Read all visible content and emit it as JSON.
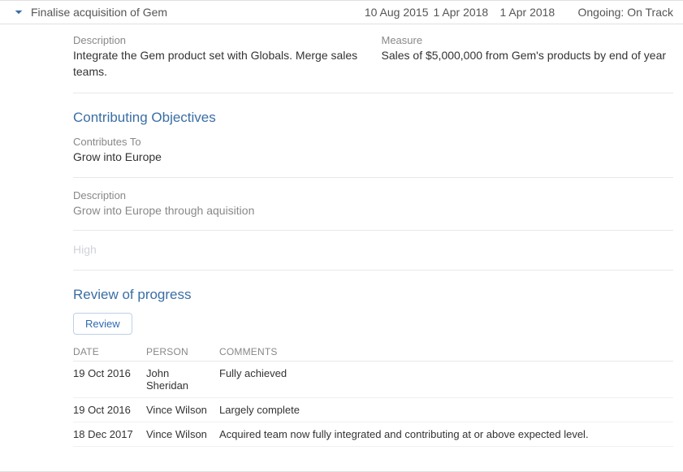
{
  "header": {
    "title": "Finalise acquisition of Gem",
    "date1": "10 Aug 2015",
    "date2": "1 Apr 2018",
    "date3": "1 Apr 2018",
    "status": "Ongoing: On Track"
  },
  "details": {
    "description_label": "Description",
    "description_value": "Integrate the Gem product set with Globals. Merge sales teams.",
    "measure_label": "Measure",
    "measure_value": "Sales of $5,000,000 from Gem's products by end of year"
  },
  "contributing": {
    "title": "Contributing Objectives",
    "contributes_to_label": "Contributes To",
    "contributes_to_value": "Grow into Europe",
    "description_label": "Description",
    "description_value": "Grow into Europe through aquisition",
    "priority_value": "High"
  },
  "review": {
    "title": "Review of progress",
    "button_label": "Review",
    "columns": {
      "date": "DATE",
      "person": "PERSON",
      "comments": "COMMENTS"
    },
    "rows": [
      {
        "date": "19 Oct 2016",
        "person": "John Sheridan",
        "comments": "Fully achieved"
      },
      {
        "date": "19 Oct 2016",
        "person": "Vince Wilson",
        "comments": "Largely complete"
      },
      {
        "date": "18 Dec 2017",
        "person": "Vince Wilson",
        "comments": "Acquired team now fully integrated and contributing at or above expected level."
      }
    ]
  }
}
